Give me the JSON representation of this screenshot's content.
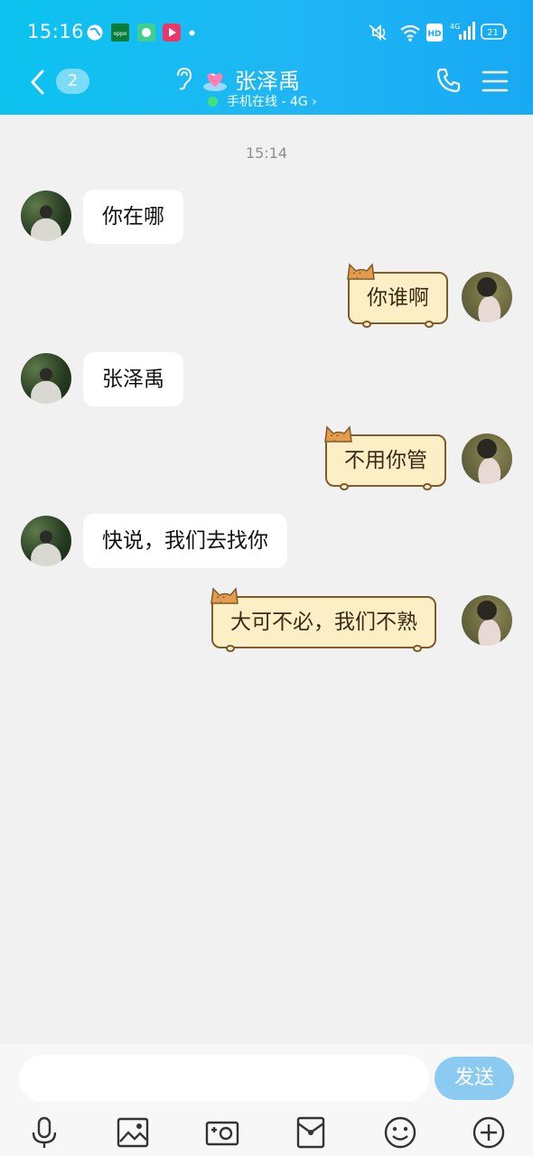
{
  "status_bar": {
    "time": "15:16",
    "battery": "21",
    "network": "4G",
    "hd": "HD"
  },
  "header": {
    "unread_count": "2",
    "contact_name": "张泽禹",
    "presence": "手机在线 - 4G",
    "chevron": "›"
  },
  "chat": {
    "timestamp": "15:14",
    "messages": [
      {
        "side": "left",
        "text": "你在哪"
      },
      {
        "side": "right",
        "text": "你谁啊"
      },
      {
        "side": "left",
        "text": "张泽禹"
      },
      {
        "side": "right",
        "text": "不用你管"
      },
      {
        "side": "left",
        "text": "快说，我们去找你"
      },
      {
        "side": "right",
        "text": "大可不必，我们不熟"
      }
    ]
  },
  "input": {
    "value": "",
    "send_label": "发送"
  },
  "toolbar": {
    "icons": [
      "mic-icon",
      "image-icon",
      "camera-icon",
      "red-packet-icon",
      "emoji-icon",
      "plus-icon"
    ]
  },
  "colors": {
    "header_start": "#0cc3ef",
    "header_end": "#17a9f3",
    "send_button": "#8ccbf1",
    "sticker_bubble": "#fcefc6",
    "online": "#3fe37a"
  }
}
